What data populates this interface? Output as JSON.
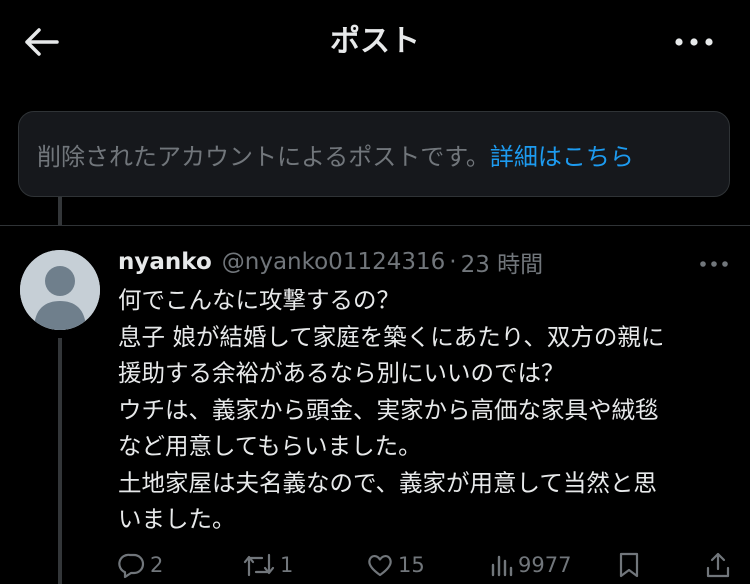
{
  "header": {
    "title": "ポスト"
  },
  "notice": {
    "text": "削除されたアカウントによるポストです。",
    "link": "詳細はこちら"
  },
  "reply": {
    "name": "nyanko",
    "handle": "@nyanko01124316",
    "separator": "·",
    "time": "23 時間",
    "lines": [
      "何でこんなに攻撃するの？",
      "息子 娘が結婚して家庭を築くにあたり、双方の親に",
      "援助する余裕があるなら別にいいのでは？",
      "ウチは、義家から頭金、実家から高価な家具や絨毯",
      "など用意してもらいました。",
      "土地家屋は夫名義なので、義家が用意して当然と思",
      "いました。"
    ],
    "actions": {
      "replies": "2",
      "reposts": "1",
      "likes": "15",
      "views": "9977"
    }
  },
  "colors": {
    "background": "#000000",
    "text": "#e7e9ea",
    "muted": "#71767b",
    "link": "#1d9bf0",
    "border": "#2f3336"
  },
  "icons": [
    "back-arrow-icon",
    "more-horizontal-icon",
    "reply-icon",
    "repost-icon",
    "like-icon",
    "views-icon",
    "bookmark-icon",
    "share-icon"
  ]
}
